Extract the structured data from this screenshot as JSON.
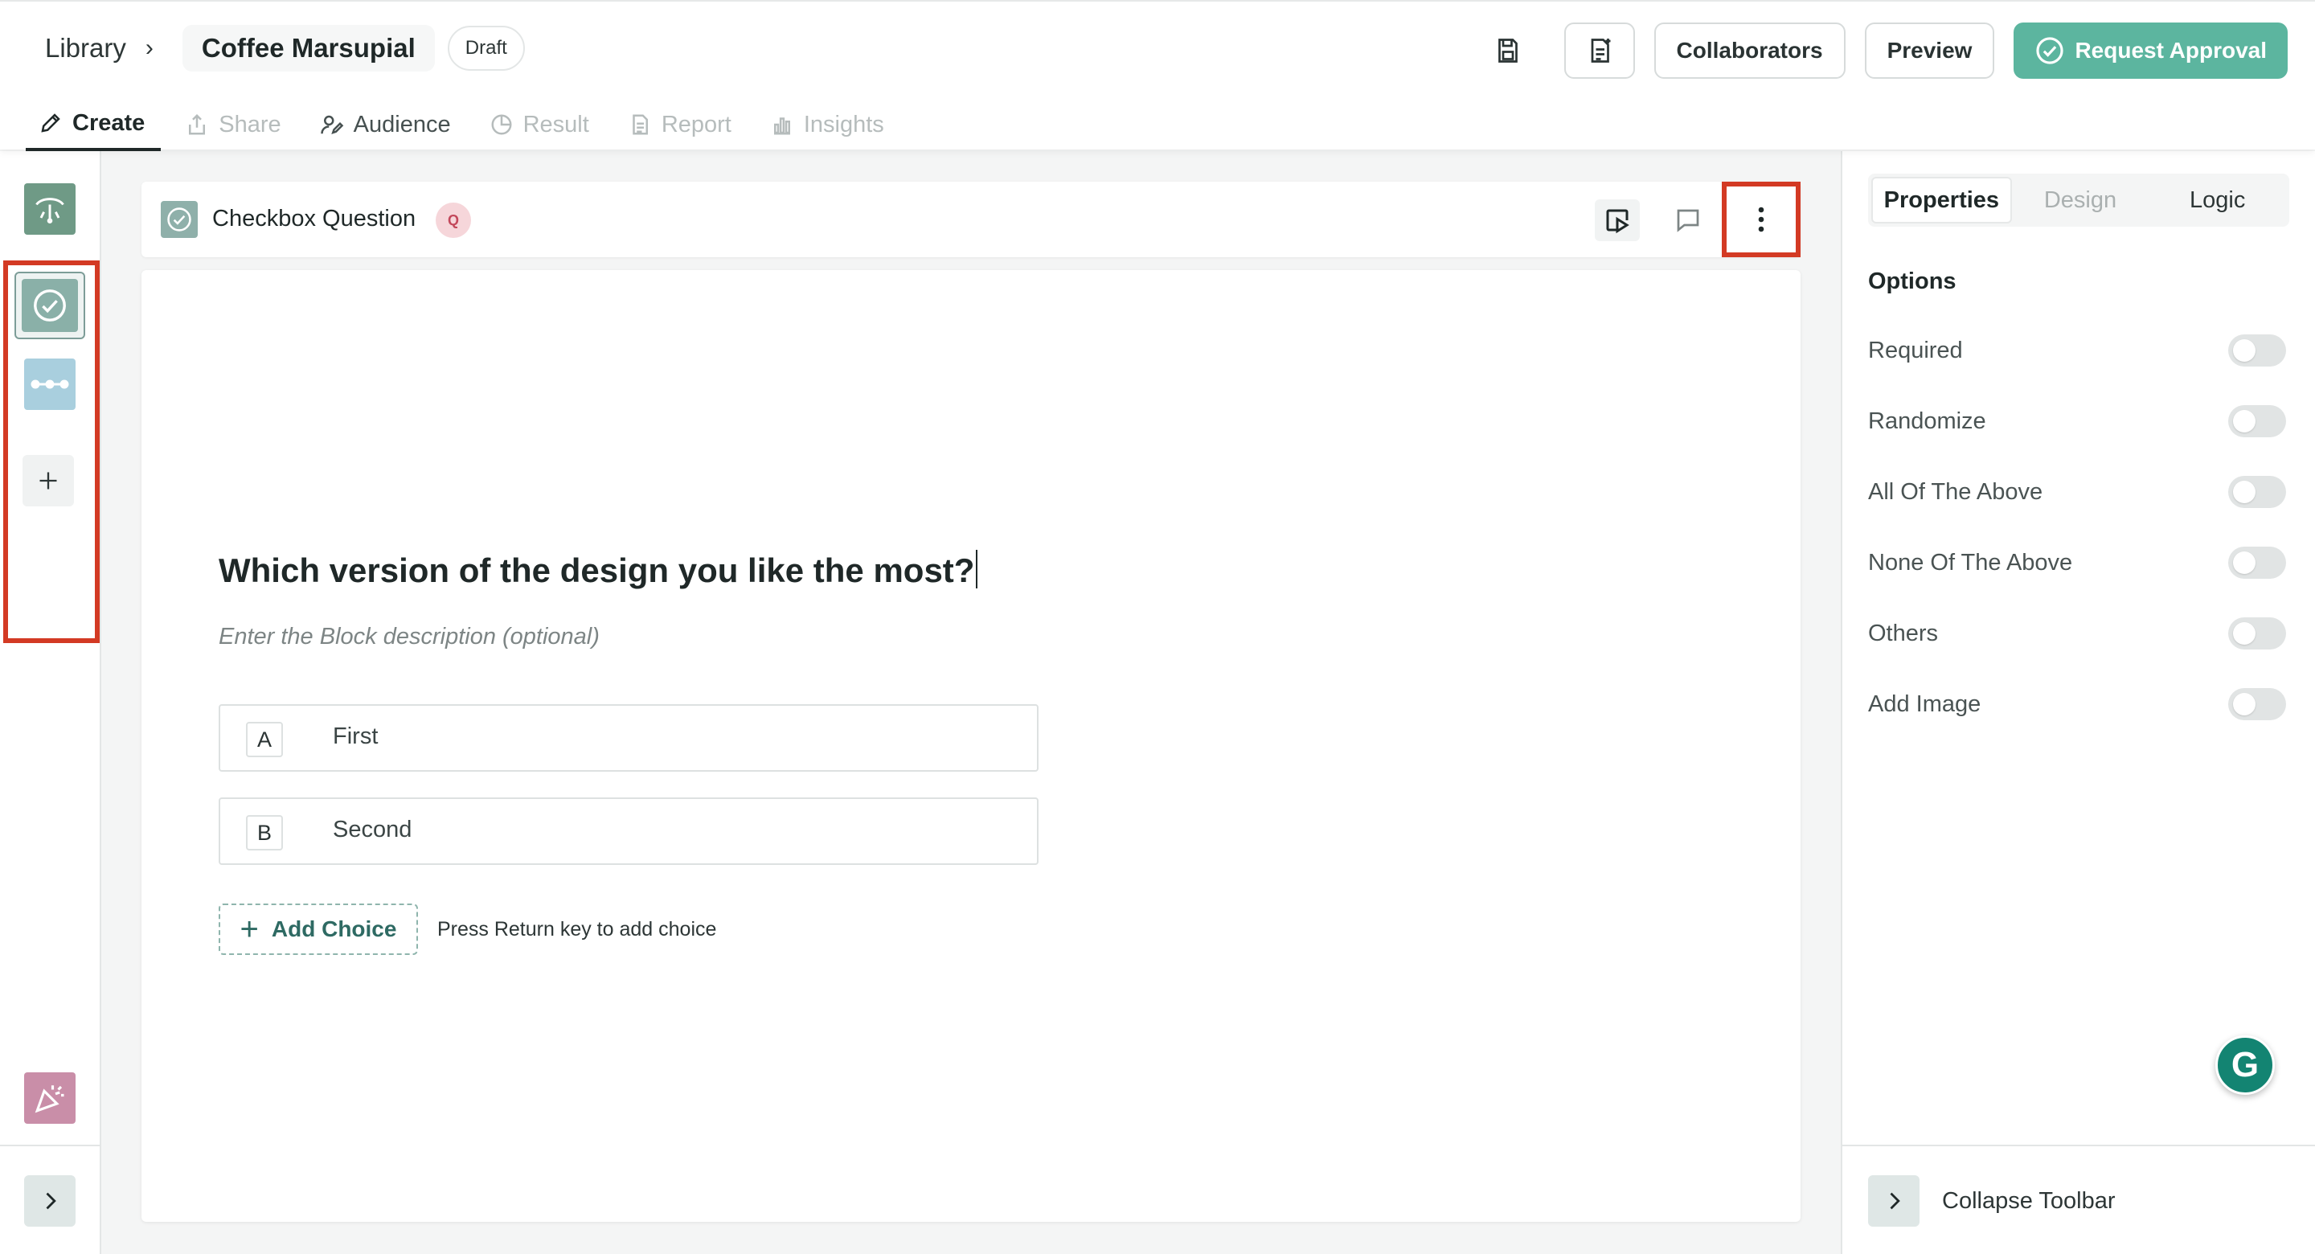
{
  "breadcrumb": {
    "root": "Library",
    "separator": "›",
    "project": "Coffee Marsupial",
    "status": "Draft"
  },
  "header_actions": {
    "collaborators": "Collaborators",
    "preview": "Preview",
    "request_approval": "Request Approval"
  },
  "tabs": [
    {
      "label": "Create",
      "state": "active",
      "icon": "pencil-icon"
    },
    {
      "label": "Share",
      "state": "disabled",
      "icon": "share-icon"
    },
    {
      "label": "Audience",
      "state": "normal",
      "icon": "audience-icon"
    },
    {
      "label": "Result",
      "state": "disabled",
      "icon": "pie-chart-icon"
    },
    {
      "label": "Report",
      "state": "disabled",
      "icon": "document-icon"
    },
    {
      "label": "Insights",
      "state": "disabled",
      "icon": "bar-chart-icon"
    }
  ],
  "question_header": {
    "type_label": "Checkbox Question",
    "badge": "Q"
  },
  "question": {
    "text": "Which version of the design you like the most?",
    "description_placeholder": "Enter the Block description (optional)",
    "choices": [
      {
        "key": "A",
        "label": "First"
      },
      {
        "key": "B",
        "label": "Second"
      }
    ],
    "add_choice_label": "Add Choice",
    "add_choice_hint": "Press Return key to add choice"
  },
  "right_panel": {
    "tabs": [
      "Properties",
      "Design",
      "Logic"
    ],
    "options_heading": "Options",
    "options": [
      {
        "label": "Required",
        "enabled": false
      },
      {
        "label": "Randomize",
        "enabled": false
      },
      {
        "label": "All Of The Above",
        "enabled": false
      },
      {
        "label": "None Of The Above",
        "enabled": false
      },
      {
        "label": "Others",
        "enabled": false
      },
      {
        "label": "Add Image",
        "enabled": false
      }
    ],
    "collapse_label": "Collapse Toolbar",
    "grammarly_letter": "G"
  },
  "colors": {
    "accent": "#5cb59f",
    "highlight": "#d33a24",
    "question_badge": "#f6d6da"
  }
}
